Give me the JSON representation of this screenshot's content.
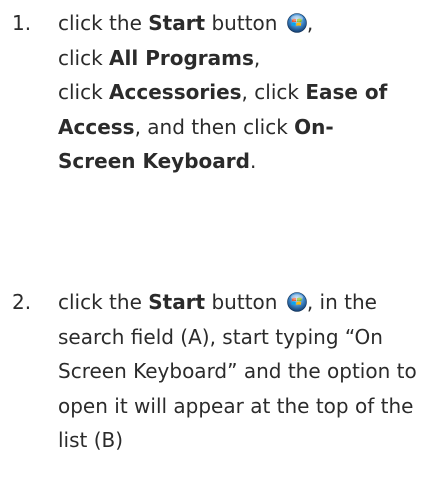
{
  "steps": [
    {
      "number": "1.",
      "line1_pre": "click the ",
      "line1_bold": "Start",
      "line1_post": " button",
      "line1_end": ",",
      "line2_pre": "click ",
      "line2_bold": "All Programs",
      "line2_post": ",",
      "line3_pre": "click ",
      "line3_bold": "Accessories",
      "line3_mid": ", click ",
      "line3_bold2": "Ease of",
      "line4_bold": "Access",
      "line4_mid": ", and then click ",
      "line4_bold2": "On-",
      "line5_bold": "Screen Keyboard",
      "line5_post": "."
    },
    {
      "number": "2.",
      "line1_pre": "click the ",
      "line1_bold": "Start",
      "line1_post": " button",
      "line1_end": ",  in the",
      "rest": "search field (A), start typing “On Screen Keyboard” and the option to open it will appear at the top of the list (B)"
    }
  ],
  "icons": {
    "start_button": "windows-start-orb-icon"
  }
}
